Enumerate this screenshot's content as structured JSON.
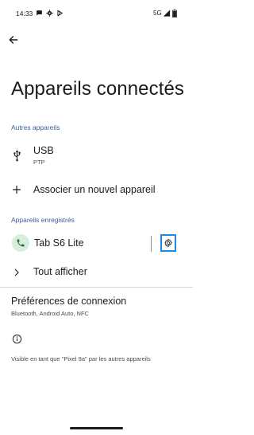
{
  "status_bar": {
    "time": "14:33",
    "network": "5G",
    "icons": [
      "chat-icon",
      "gear-icon",
      "play-store-icon",
      "signal-icon",
      "battery-icon"
    ]
  },
  "header": {
    "back_icon": "arrow-left-icon",
    "title": "Appareils connectés"
  },
  "other_devices": {
    "section_label": "Autres appareils",
    "usb": {
      "title": "USB",
      "subtitle": "PTP",
      "icon": "usb-icon"
    },
    "pair": {
      "title": "Associer un nouvel appareil",
      "icon": "plus-icon"
    }
  },
  "saved_devices": {
    "section_label": "Appareils enregistrés",
    "device": {
      "name": "Tab S6 Lite",
      "icon": "phone-icon",
      "settings_icon": "gear-icon"
    },
    "show_all": {
      "label": "Tout afficher",
      "icon": "chevron-right-icon"
    }
  },
  "connection_prefs": {
    "title": "Préférences de connexion",
    "subtitle": "Bluetooth, Android Auto, NFC"
  },
  "visibility": {
    "icon": "info-icon",
    "text": "Visible en tant que \"Pixel 9a\" par les autres appareils"
  },
  "colors": {
    "section_accent": "#3a5f9a",
    "focus_outline": "#1e88e5",
    "phone_badge_bg": "#d6eedb",
    "phone_icon": "#2e6b3c"
  }
}
